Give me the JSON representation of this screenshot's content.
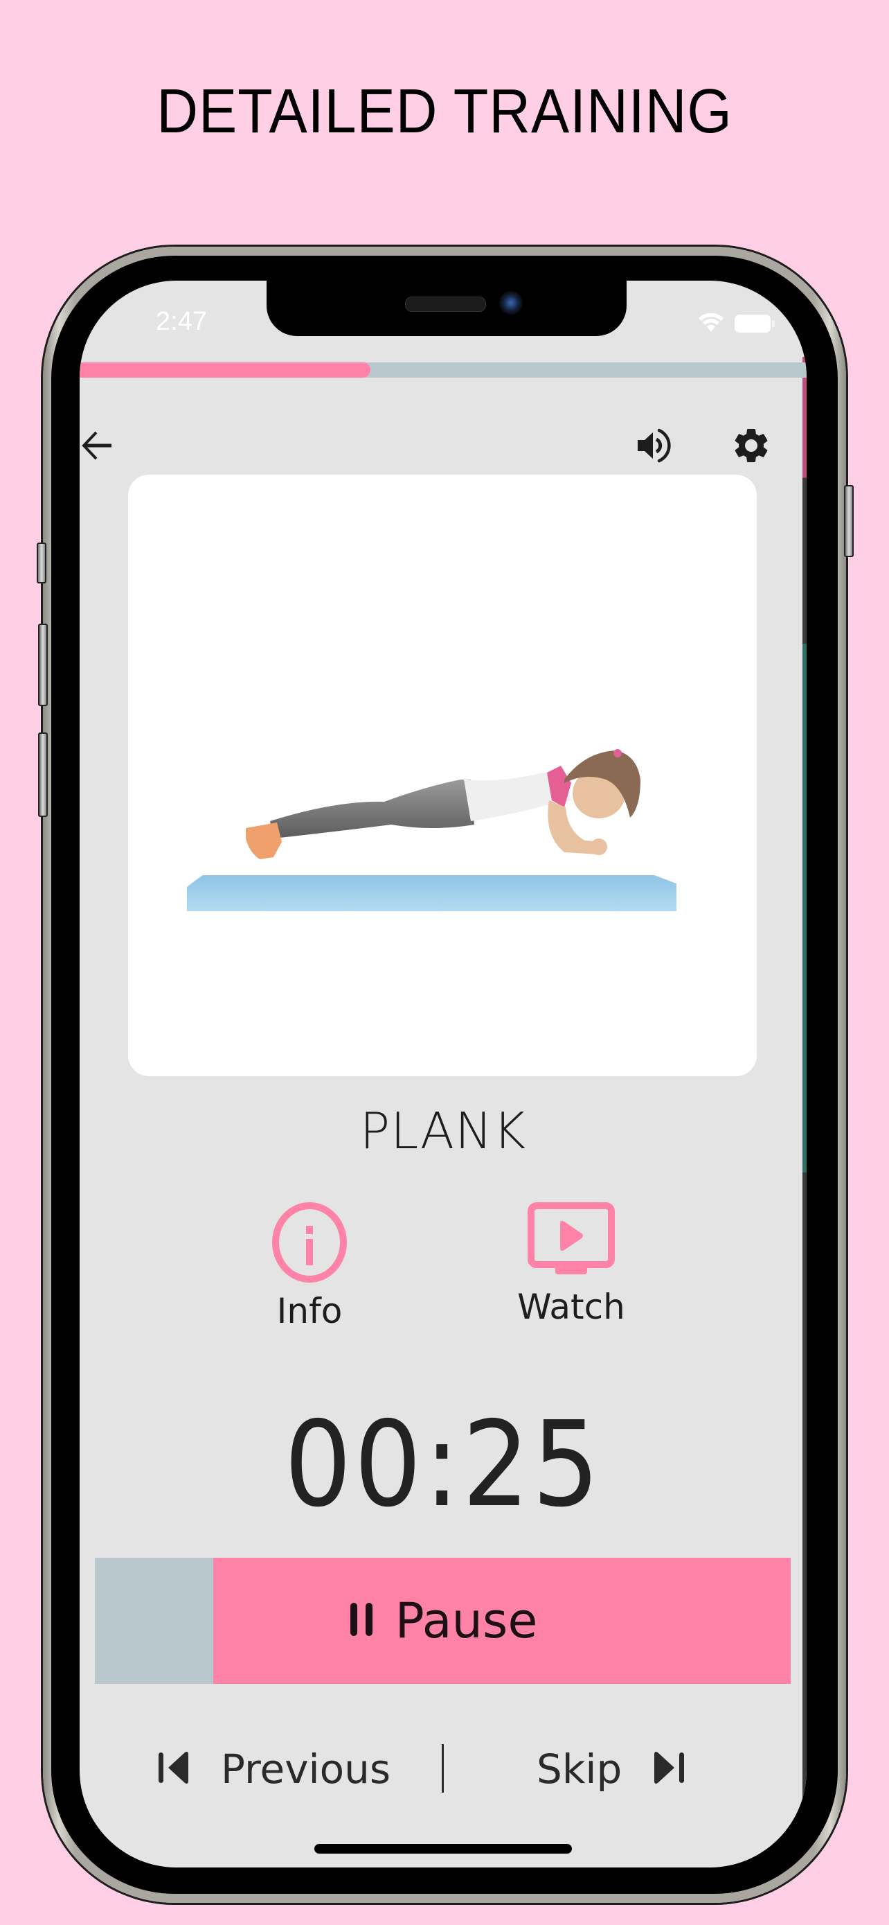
{
  "headline": "DETAILED TRAINING",
  "status_bar": {
    "time": "2:47",
    "icons": [
      "wifi-icon",
      "battery-icon"
    ]
  },
  "workout_progress": {
    "fraction": 0.4
  },
  "toolbar": {
    "back_icon": "arrow-left-icon",
    "sound_icon": "speaker-icon",
    "settings_icon": "gear-icon"
  },
  "exercise": {
    "name": "PLANK",
    "illustration": "girl-doing-forearm-plank-on-blue-mat"
  },
  "actions": [
    {
      "label": "Info",
      "icon": "info-circle-icon"
    },
    {
      "label": "Watch",
      "icon": "video-play-icon"
    }
  ],
  "timer": {
    "value": "00:25",
    "elapsed_fraction": 0.17
  },
  "pause_button": {
    "label": "Pause",
    "icon": "pause-icon"
  },
  "navigation": {
    "previous_label": "Previous",
    "skip_label": "Skip"
  },
  "colors": {
    "background": "#FFCFE6",
    "accent": "#FF82A9",
    "track": "#B8C8CC",
    "screen": "#E4E4E4"
  }
}
